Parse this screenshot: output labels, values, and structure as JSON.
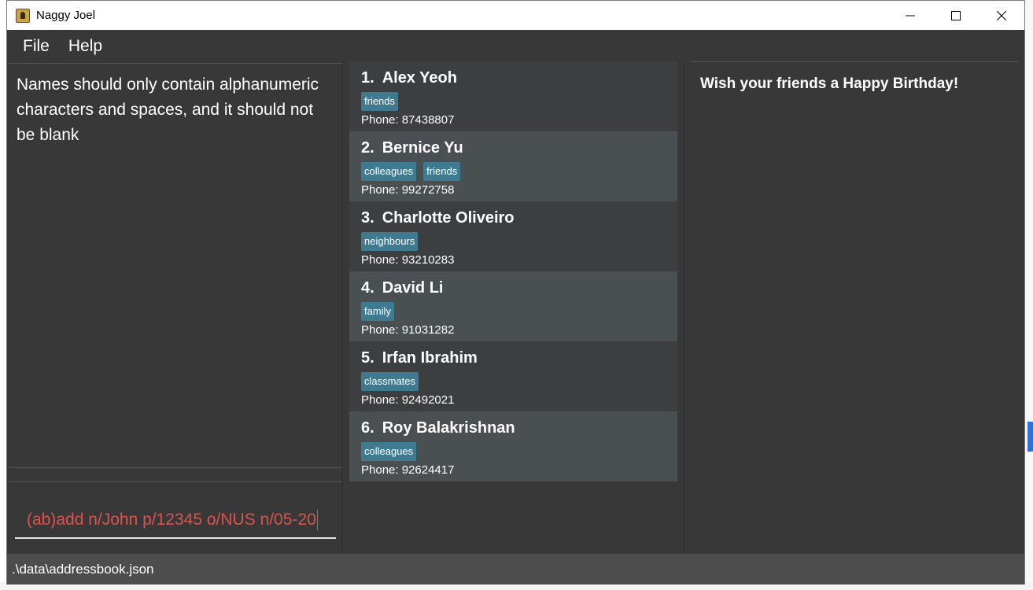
{
  "window": {
    "title": "Naggy Joel"
  },
  "menu": {
    "items": [
      "File",
      "Help"
    ]
  },
  "result_display": {
    "text": "Names should only contain alphanumeric characters and spaces, and it should not be blank"
  },
  "command_box": {
    "value": "(ab)add n/John p/12345 o/NUS n/05-20"
  },
  "persons": [
    {
      "index": "1.",
      "name": "Alex Yeoh",
      "tags": [
        "friends"
      ],
      "phone": "Phone: 87438807"
    },
    {
      "index": "2.",
      "name": "Bernice Yu",
      "tags": [
        "colleagues",
        "friends"
      ],
      "phone": "Phone: 99272758"
    },
    {
      "index": "3.",
      "name": "Charlotte Oliveiro",
      "tags": [
        "neighbours"
      ],
      "phone": "Phone: 93210283"
    },
    {
      "index": "4.",
      "name": "David Li",
      "tags": [
        "family"
      ],
      "phone": "Phone: 91031282"
    },
    {
      "index": "5.",
      "name": "Irfan Ibrahim",
      "tags": [
        "classmates"
      ],
      "phone": "Phone: 92492021"
    },
    {
      "index": "6.",
      "name": "Roy Balakrishnan",
      "tags": [
        "colleagues"
      ],
      "phone": "Phone: 92624417"
    }
  ],
  "birthday_panel": {
    "text": "Wish your friends a Happy Birthday!"
  },
  "status_bar": {
    "path": ".\\data\\addressbook.json"
  },
  "colors": {
    "background": "#383838",
    "tag": "#3e7b91",
    "command_text": "#d9534f",
    "card_odd": "#3c3e3f",
    "card_even": "#4a5052"
  }
}
